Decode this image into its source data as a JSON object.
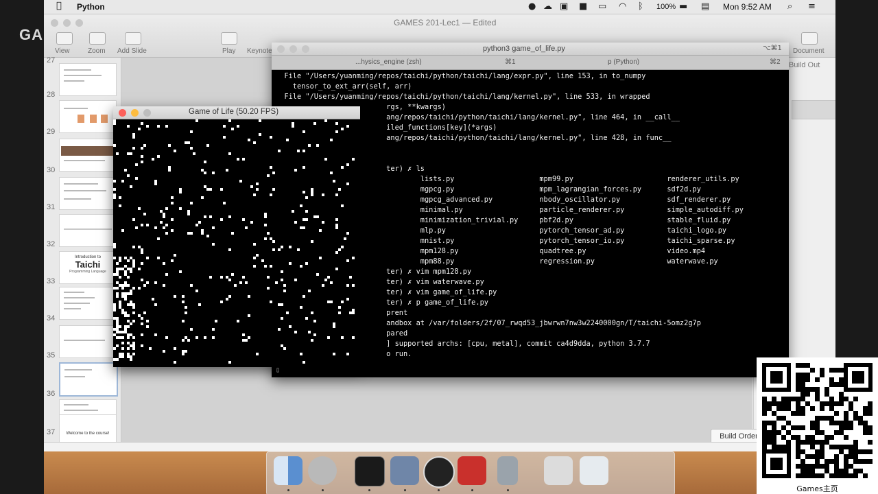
{
  "outer": {
    "left_text": "GA"
  },
  "menubar": {
    "app_name": "Python",
    "battery": "100%",
    "clock": "Mon 9:52 AM"
  },
  "keynote": {
    "title": "GAMES 201-Lec1 — Edited",
    "toolbar": [
      "View",
      "Zoom",
      "Add Slide",
      "Play",
      "Keynote",
      "Document"
    ],
    "build_out": "Build Out",
    "build_order": "Build Order",
    "slide_numbers": [
      "27",
      "28",
      "29",
      "30",
      "31",
      "32",
      "33",
      "34",
      "35",
      "36",
      "37"
    ],
    "slide_texts": {
      "s32_intro": "Introduction to",
      "s32_brand": "Taichi",
      "s32_sub": "Programming Language",
      "s37": "Welcome to the course!"
    }
  },
  "terminal": {
    "title": "python3 game_of_life.py",
    "tab1": "...hysics_engine (zsh)",
    "tab1_shortcut": "⌘1",
    "tab2": "p (Python)",
    "tab2_shortcut": "⌘2",
    "close_shortcut": "⌥⌘1",
    "lines": [
      "  File \"/Users/yuanming/repos/taichi/python/taichi/lang/expr.py\", line 153, in to_numpy",
      "    tensor_to_ext_arr(self, arr)",
      "  File \"/Users/yuanming/repos/taichi/python/taichi/lang/kernel.py\", line 533, in wrapped",
      "                          rgs, **kwargs)",
      "                          ang/repos/taichi/python/taichi/lang/kernel.py\", line 464, in __call__",
      "                          iled_functions[key](*args)",
      "                          ang/repos/taichi/python/taichi/lang/kernel.py\", line 428, in func__",
      "",
      "",
      "                          ter) ✗ ls",
      "                                  lists.py                    mpm99.py                      renderer_utils.py",
      "                                  mgpcg.py                    mpm_lagrangian_forces.py      sdf2d.py",
      "                                  mgpcg_advanced.py           nbody_oscillator.py           sdf_renderer.py",
      "                                  minimal.py                  particle_renderer.py          simple_autodiff.py",
      "                                  minimization_trivial.py     pbf2d.py                      stable_fluid.py",
      "                                  mlp.py                      pytorch_tensor_ad.py          taichi_logo.py",
      "                                  mnist.py                    pytorch_tensor_io.py          taichi_sparse.py",
      "                                  mpm128.py                   quadtree.py                   video.mp4",
      "                                  mpm88.py                    regression.py                 waterwave.py",
      "                          ter) ✗ vim mpm128.py",
      "                          ter) ✗ vim waterwave.py",
      "                          ter) ✗ vim game_of_life.py",
      "                          ter) ✗ p game_of_life.py",
      "                          prent",
      "                          andbox at /var/folders/2f/07_rwqd53_jbwrwn7nw3w2240000gn/T/taichi-5omz2g7p",
      "                          pared",
      "                          ] supported archs: [cpu, metal], commit ca4d9dda, python 3.7.7",
      "                          o run.",
      "▯"
    ]
  },
  "game_window": {
    "title": "Game of Life (50.20 FPS)"
  },
  "qr": {
    "caption": "Games主页"
  },
  "colors": {
    "terminal_bg": "#000000",
    "terminal_fg": "#f2f2f2",
    "dock_bg": "#b6773f",
    "close": "#fc605b",
    "minimize": "#fdbc40"
  },
  "icons": [
    "apple-logo-icon",
    "wifi-icon",
    "bluetooth-icon",
    "volume-icon",
    "battery-icon",
    "search-icon",
    "notification-icon",
    "finder-icon",
    "terminal-icon",
    "keynote-icon",
    "obs-icon",
    "acrobat-icon",
    "trash-icon"
  ]
}
